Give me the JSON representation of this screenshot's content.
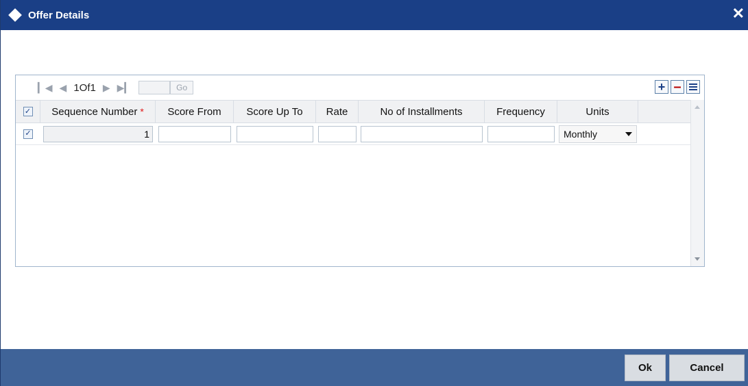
{
  "window": {
    "title": "Offer Details",
    "close_glyph": "✕"
  },
  "pagination": {
    "first_icon": "first-page-icon",
    "prev_icon": "previous-page-icon",
    "next_icon": "next-page-icon",
    "last_icon": "last-page-icon",
    "page_text": "1Of1",
    "page_input_value": "",
    "go_label": "Go"
  },
  "tools": {
    "add_icon": "plus-icon",
    "delete_icon": "minus-icon",
    "list_icon": "list-view-icon"
  },
  "grid": {
    "columns": [
      {
        "label": "",
        "type": "checkbox"
      },
      {
        "label": "Sequence Number",
        "required": true
      },
      {
        "label": "Score From"
      },
      {
        "label": "Score Up To"
      },
      {
        "label": "Rate"
      },
      {
        "label": "No of Installments"
      },
      {
        "label": "Frequency"
      },
      {
        "label": "Units"
      }
    ],
    "header_checkbox_checked": true,
    "required_mark": "*",
    "rows": [
      {
        "checked": true,
        "sequence_number": "1",
        "score_from": "",
        "score_up_to": "",
        "rate": "",
        "installments": "",
        "frequency": "",
        "units": "Monthly"
      }
    ]
  },
  "footer": {
    "ok_label": "Ok",
    "cancel_label": "Cancel"
  },
  "colors": {
    "titlebar": "#1a3f86",
    "footer": "#3f6398",
    "required": "#e01818"
  }
}
